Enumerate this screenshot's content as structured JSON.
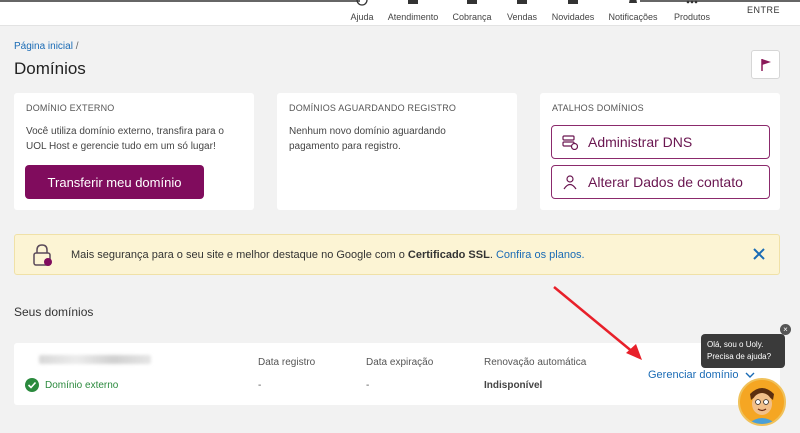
{
  "topnav": {
    "items": [
      {
        "label": "Ajuda",
        "icon": "help-circle-icon"
      },
      {
        "label": "Atendimento",
        "icon": "chat-icon"
      },
      {
        "label": "Cobrança",
        "icon": "billing-icon"
      },
      {
        "label": "Vendas",
        "icon": "cart-icon"
      },
      {
        "label": "Novidades",
        "icon": "gift-icon"
      },
      {
        "label": "Notificações",
        "icon": "bell-icon"
      },
      {
        "label": "Produtos",
        "icon": "grid-icon"
      }
    ],
    "login_label": "ENTRE"
  },
  "breadcrumb": {
    "home": "Página inicial",
    "separator": "/"
  },
  "page_title": "Domínios",
  "cards": {
    "external": {
      "title": "DOMÍNIO EXTERNO",
      "text": "Você utiliza domínio externo, transfira para o UOL Host e gerencie tudo em um só lugar!",
      "button": "Transferir meu domínio"
    },
    "pending": {
      "title": "DOMÍNIOS AGUARDANDO REGISTRO",
      "text": "Nenhum novo domínio aguardando pagamento para registro."
    },
    "shortcuts": {
      "title": "ATALHOS DOMÍNIOS",
      "dns_button": "Administrar DNS",
      "contact_button": "Alterar Dados de contato"
    }
  },
  "ssl_banner": {
    "text_before": "Mais segurança para o seu site e melhor destaque no Google com o ",
    "bold": "Certificado SSL",
    "text_after": ". ",
    "link": "Confira os planos."
  },
  "domains_section": {
    "title": "Seus domínios",
    "columns": {
      "registered": "Data registro",
      "expires": "Data expiração",
      "renewal": "Renovação automática"
    },
    "row": {
      "status": "Domínio externo",
      "registered": "-",
      "expires": "-",
      "renewal": "Indisponível",
      "manage": "Gerenciar domínio"
    }
  },
  "chat": {
    "line1": "Olá, sou o Uoly.",
    "line2": "Precisa de ajuda?",
    "close": "×"
  },
  "colors": {
    "primary": "#800c5d",
    "link": "#1a6bb5",
    "success": "#2b8a3e",
    "banner_bg": "#fcf4d4",
    "arrow": "#e8202a"
  }
}
